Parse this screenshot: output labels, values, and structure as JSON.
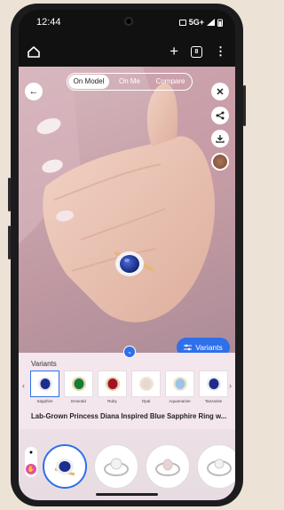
{
  "status": {
    "time": "12:44",
    "network": "5G+"
  },
  "appbar": {
    "tab_count": "8"
  },
  "viewer": {
    "modes": [
      "On Model",
      "On Me",
      "Compare"
    ],
    "active_mode": "On Model",
    "variants_button_label": "Variants"
  },
  "variants": {
    "title": "Variants",
    "items": [
      {
        "label": "Sapphire",
        "color": "#1b2f8f",
        "selected": true
      },
      {
        "label": "Emerald",
        "color": "#137a3a",
        "selected": false
      },
      {
        "label": "Ruby",
        "color": "#a3122a",
        "selected": false
      },
      {
        "label": "Opal",
        "color": "#e8d8d2",
        "selected": false
      },
      {
        "label": "Aquamarine",
        "color": "#9cc3e6",
        "selected": false
      },
      {
        "label": "Tanzanite",
        "color": "#1d2c8a",
        "selected": false
      }
    ]
  },
  "product": {
    "title": "Lab-Grown Princess Diana Inspired Blue Sapphire Ring w..."
  },
  "colors": {
    "accent": "#2f6fea",
    "panel": "#f3e6ec",
    "toggle_on": "#e04fa8"
  }
}
